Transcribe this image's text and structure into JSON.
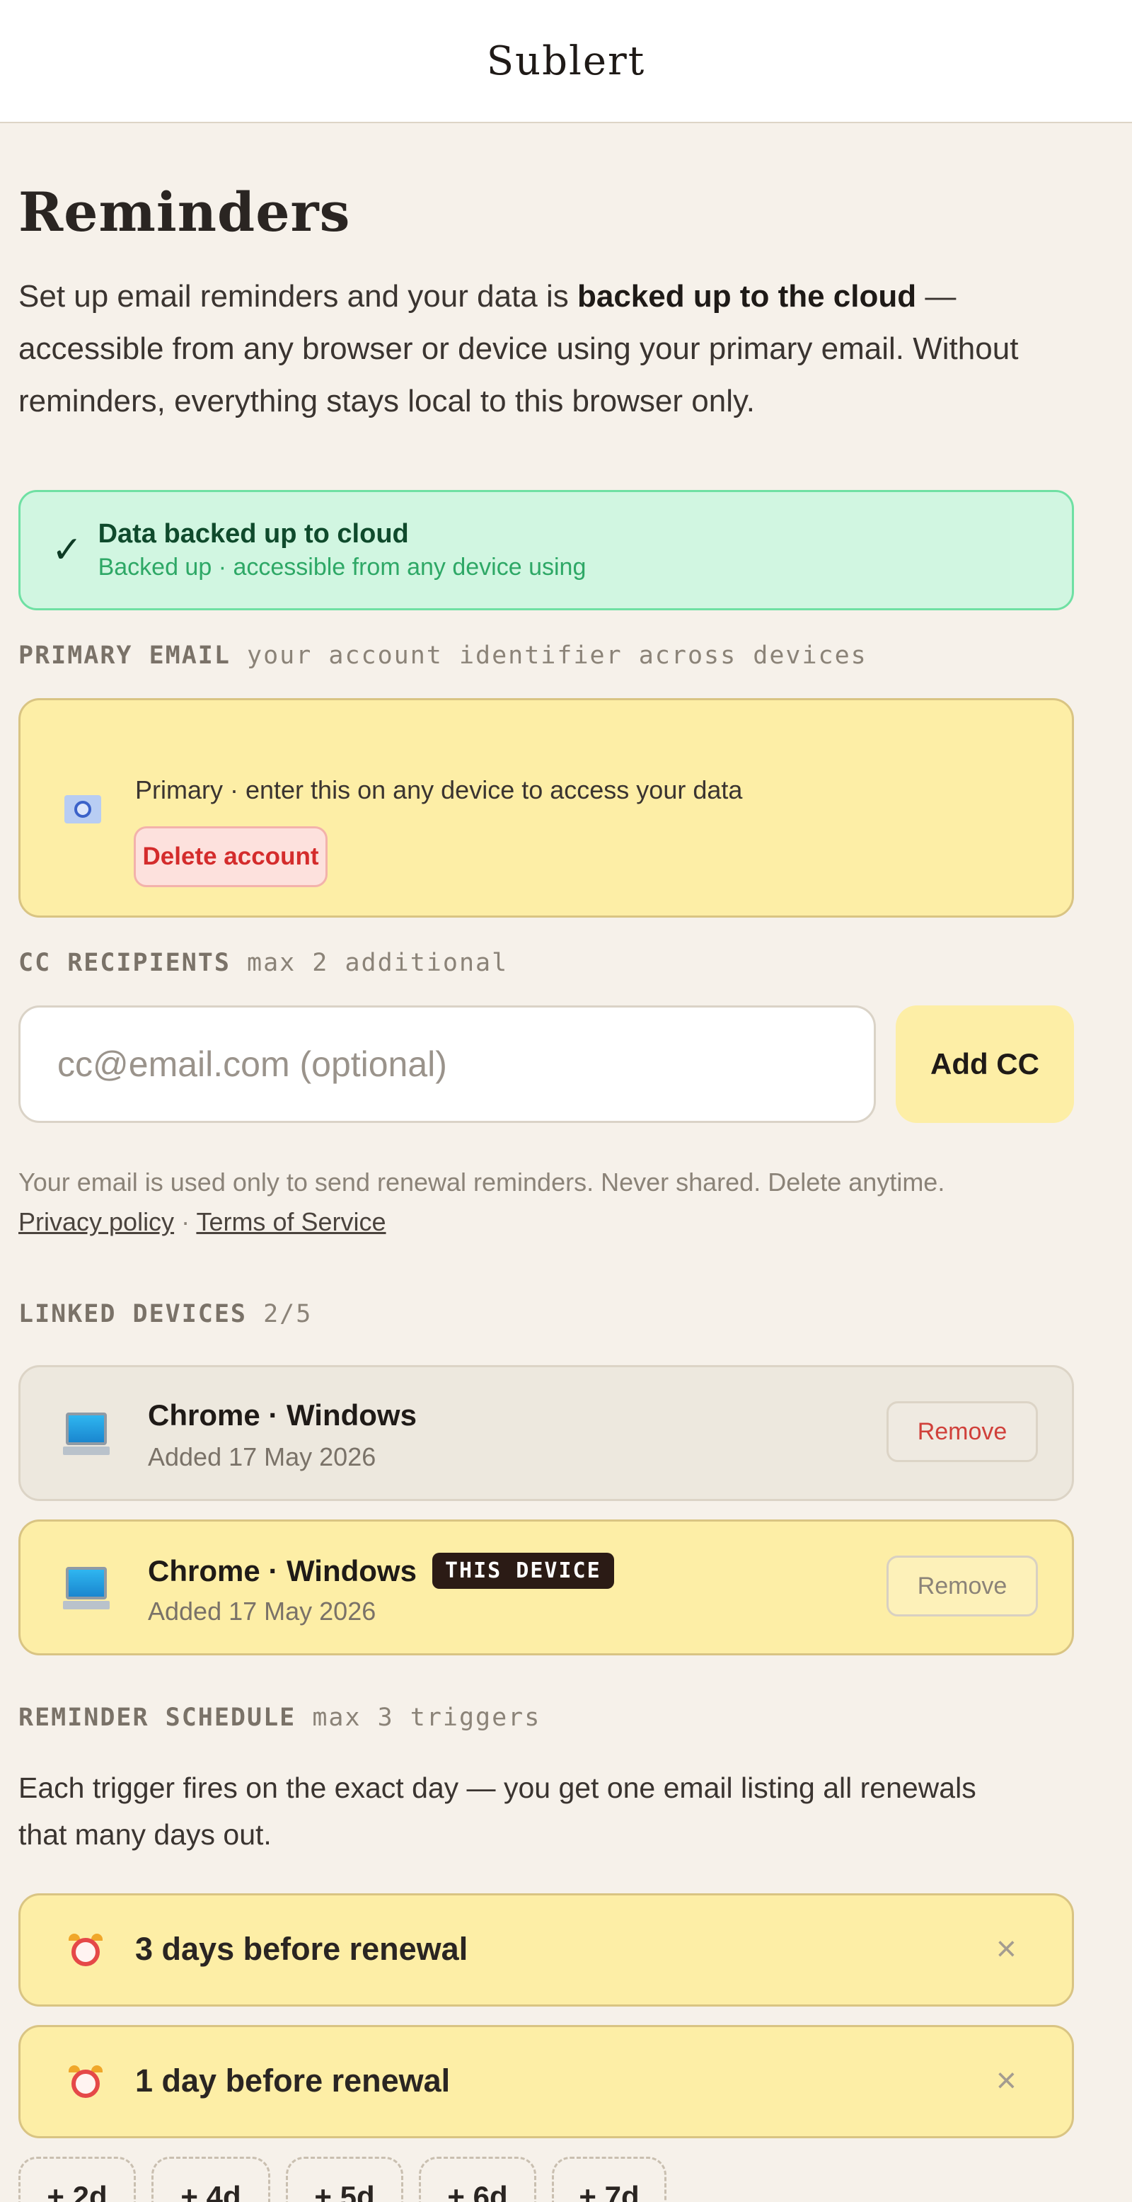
{
  "app": {
    "title": "Sublert"
  },
  "page": {
    "title": "Reminders",
    "intro_before": "Set up email reminders and your data is ",
    "intro_bold": "backed up to the cloud",
    "intro_after": " — accessible from any browser or device using your primary email. Without reminders, everything stays local to this browser only."
  },
  "status": {
    "icon": "check-icon",
    "title": "Data backed up to cloud",
    "subtitle": "Backed up · accessible from any device using"
  },
  "primary": {
    "label": "PRIMARY EMAIL",
    "hint_label": "your account identifier across devices",
    "description": "Primary · enter this on any device to access your data",
    "delete_label": "Delete account"
  },
  "cc": {
    "label": "CC RECIPIENTS",
    "hint_label": "max 2 additional",
    "placeholder": "cc@email.com (optional)",
    "button_label": "Add CC"
  },
  "fineprint": {
    "text": "Your email is used only to send renewal reminders. Never shared. Delete anytime.",
    "privacy_link": "Privacy policy",
    "separator": "·",
    "terms_link": "Terms of Service"
  },
  "devices": {
    "label": "LINKED DEVICES",
    "count": "2/5",
    "items": [
      {
        "name": "Chrome · Windows",
        "added": "Added 17 May 2026",
        "remove_label": "Remove"
      },
      {
        "name": "Chrome · Windows",
        "badge": "THIS DEVICE",
        "added": "Added 17 May 2026",
        "remove_label": "Remove"
      }
    ]
  },
  "schedule": {
    "label": "REMINDER SCHEDULE",
    "hint_label": "max 3 triggers",
    "intro": "Each trigger fires on the exact day — you get one email listing all renewals that many days out.",
    "triggers": [
      {
        "label": "3 days before renewal",
        "remove": "×"
      },
      {
        "label": "1 day before renewal",
        "remove": "×"
      }
    ],
    "add_options": [
      "+ 2d",
      "+ 4d",
      "+ 5d",
      "+ 6d",
      "+ 7d"
    ]
  }
}
